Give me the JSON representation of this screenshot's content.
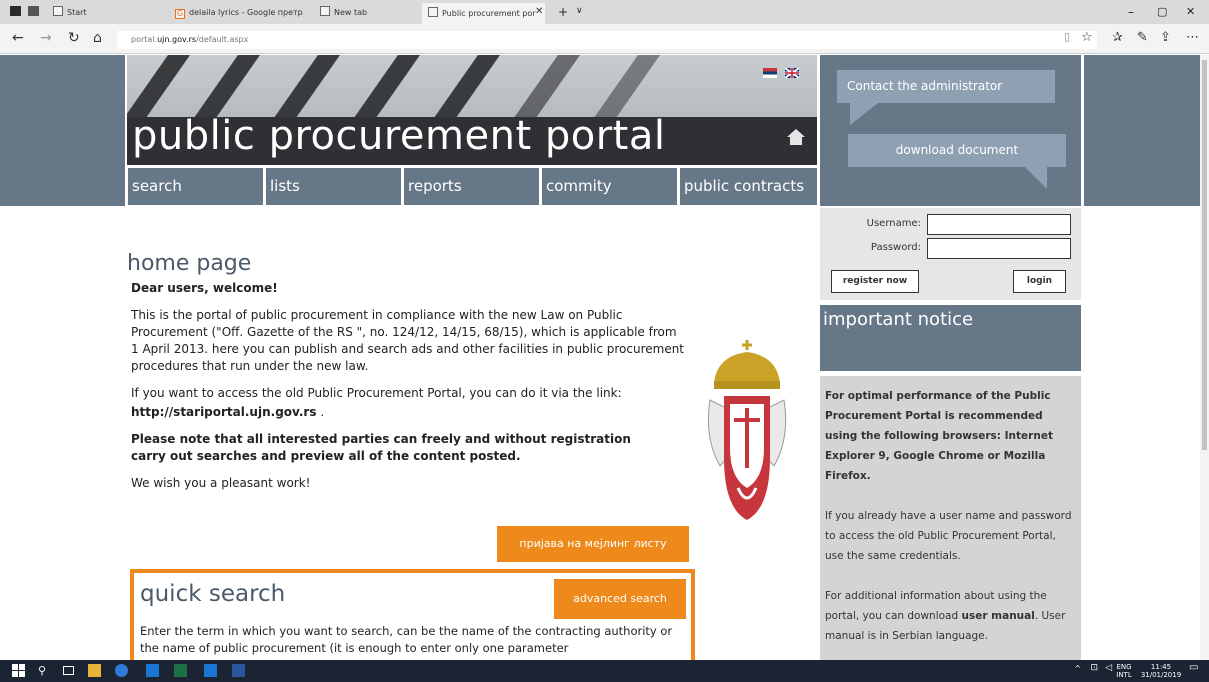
{
  "browser": {
    "tabs": [
      {
        "label": "Start"
      },
      {
        "label": "delaila lyrics - Google претр"
      },
      {
        "label": "New tab"
      },
      {
        "label": "Public procurement por"
      }
    ],
    "url_prefix": "portal.",
    "url_domain": "ujn.gov.rs",
    "url_path": "/default.aspx"
  },
  "header": {
    "title": "public procurement portal",
    "nav": [
      "search",
      "lists",
      "reports",
      "commity",
      "public contracts"
    ],
    "contact_label": "Contact the administrator",
    "download_label": "download document"
  },
  "login": {
    "username_label": "Username:",
    "password_label": "Password:",
    "register_label": "register now",
    "login_label": "login"
  },
  "notice": {
    "title": "important notice",
    "p1": "For optimal performance of the Public Procurement Portal is recommended using the following browsers: Internet Explorer 9, Google Chrome or Mozilla Firefox.",
    "p2": "If you already have a user name and password to access the old Public Procurement Portal, use the same credentials.",
    "p3a": "For additional information about using the portal, you can download ",
    "p3b": "user manual",
    "p3c": ". User manual is in Serbian language."
  },
  "main": {
    "title": "home page",
    "welcome": "Dear users, welcome!",
    "intro": "This is the portal of public procurement in compliance with the new Law on Public Procurement (\"Off. Gazette of the RS \", no. 124/12, 14/15, 68/15), which is applicable from 1 April 2013. here you can publish and search ads and other facilities in public procurement procedures that run under the new law.",
    "old_portal": "If you want to access the old Public Procurement Portal, you can do it via the link:",
    "old_link": "http://stariportal.ujn.gov.rs",
    "old_link_suffix": " .",
    "note": "Please note that all interested parties can freely and without registration carry out searches and preview all of the content posted.",
    "wish": "We wish you a pleasant work!",
    "mailing_button": "пријава на мејлинг листу"
  },
  "quick_search": {
    "title": "quick search",
    "advanced_button": "advanced search",
    "text": "Enter the term in which you want to search, can be the name of the contracting authority or the name of public procurement (it is enough to enter only one parameter"
  },
  "taskbar": {
    "lang1": "ENG",
    "lang2": "INTL",
    "time": "11:45",
    "date": "31/01/2019"
  },
  "colors": {
    "header_slate": "#667788",
    "accent_orange": "#ee8a1b",
    "callout_blue": "#8fa0b3"
  }
}
